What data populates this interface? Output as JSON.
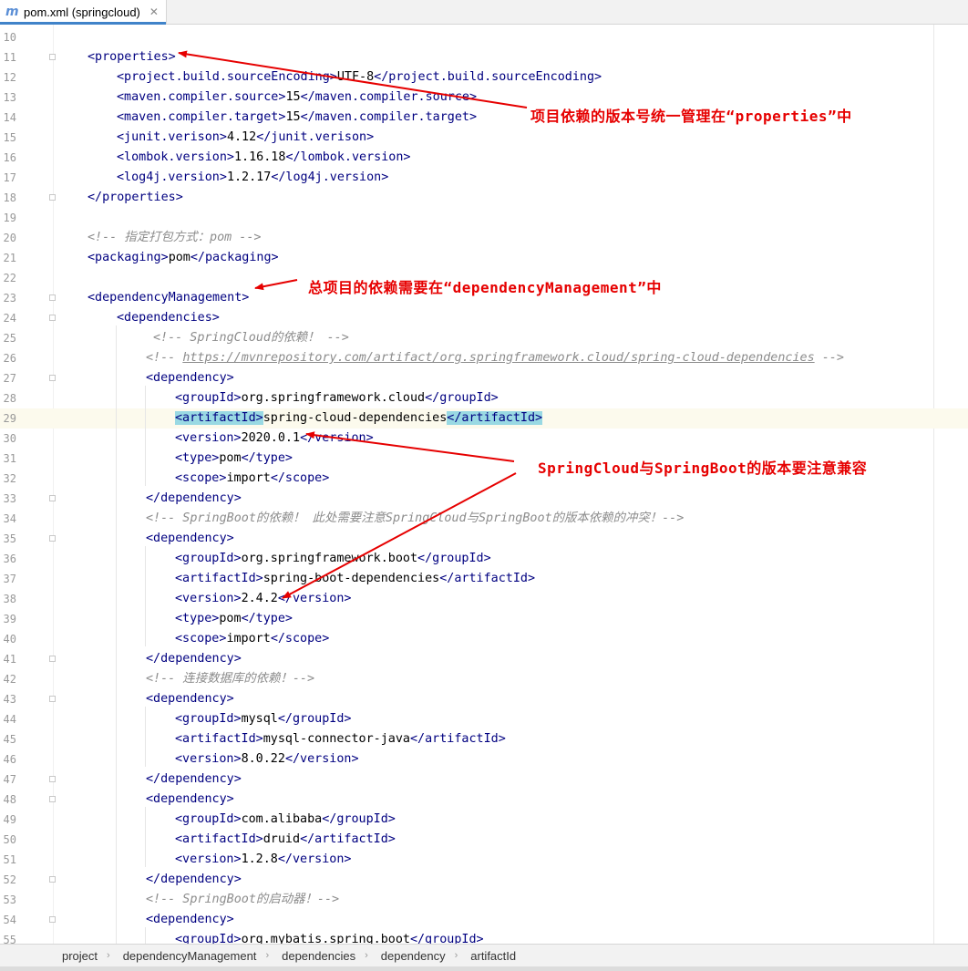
{
  "tab": {
    "icon": "maven-m-icon",
    "icon_glyph": "m",
    "title": "pom.xml (springcloud)",
    "close": "✕"
  },
  "lines": [
    {
      "n": "10",
      "indent": 0,
      "parts": []
    },
    {
      "n": "11",
      "indent": 0,
      "fold": true,
      "parts": [
        [
          "tg",
          "<properties>"
        ]
      ]
    },
    {
      "n": "12",
      "indent": 1,
      "parts": [
        [
          "tg",
          "<project.build.sourceEncoding>"
        ],
        [
          "tx",
          "UTF-8"
        ],
        [
          "tg",
          "</project.build.sourceEncoding>"
        ]
      ]
    },
    {
      "n": "13",
      "indent": 1,
      "parts": [
        [
          "tg",
          "<maven.compiler.source>"
        ],
        [
          "tx",
          "15"
        ],
        [
          "tg",
          "</maven.compiler.source>"
        ]
      ]
    },
    {
      "n": "14",
      "indent": 1,
      "parts": [
        [
          "tg",
          "<maven.compiler.target>"
        ],
        [
          "tx",
          "15"
        ],
        [
          "tg",
          "</maven.compiler.target>"
        ]
      ]
    },
    {
      "n": "15",
      "indent": 1,
      "parts": [
        [
          "tg",
          "<junit.verison>"
        ],
        [
          "tx",
          "4.12"
        ],
        [
          "tg",
          "</junit.verison>"
        ]
      ]
    },
    {
      "n": "16",
      "indent": 1,
      "parts": [
        [
          "tg",
          "<lombok.version>"
        ],
        [
          "tx",
          "1.16.18"
        ],
        [
          "tg",
          "</lombok.version>"
        ]
      ]
    },
    {
      "n": "17",
      "indent": 1,
      "parts": [
        [
          "tg",
          "<log4j.version>"
        ],
        [
          "tx",
          "1.2.17"
        ],
        [
          "tg",
          "</log4j.version>"
        ]
      ]
    },
    {
      "n": "18",
      "indent": 0,
      "fold": true,
      "parts": [
        [
          "tg",
          "</properties>"
        ]
      ]
    },
    {
      "n": "19",
      "indent": 0,
      "parts": []
    },
    {
      "n": "20",
      "indent": 0,
      "parts": [
        [
          "cm",
          "<!-- 指定打包方式：pom -->"
        ]
      ]
    },
    {
      "n": "21",
      "indent": 0,
      "parts": [
        [
          "tg",
          "<packaging>"
        ],
        [
          "tx",
          "pom"
        ],
        [
          "tg",
          "</packaging>"
        ]
      ]
    },
    {
      "n": "22",
      "indent": 0,
      "parts": []
    },
    {
      "n": "23",
      "indent": 0,
      "fold": true,
      "parts": [
        [
          "tg",
          "<dependencyManagement>"
        ]
      ]
    },
    {
      "n": "24",
      "indent": 1,
      "fold": true,
      "parts": [
        [
          "tg",
          "<dependencies>"
        ]
      ]
    },
    {
      "n": "25",
      "indent": 2.25,
      "parts": [
        [
          "cm",
          "<!-- SpringCloud的依赖！ -->"
        ]
      ]
    },
    {
      "n": "26",
      "indent": 2,
      "parts": [
        [
          "cm",
          "<!-- "
        ],
        [
          "url",
          "https://mvnrepository.com/artifact/org.springframework.cloud/spring-cloud-dependencies"
        ],
        [
          "cm",
          " -->"
        ]
      ]
    },
    {
      "n": "27",
      "indent": 2,
      "fold": true,
      "parts": [
        [
          "tg",
          "<dependency>"
        ]
      ]
    },
    {
      "n": "28",
      "indent": 3,
      "parts": [
        [
          "tg",
          "<groupId>"
        ],
        [
          "tx",
          "org.springframework.cloud"
        ],
        [
          "tg",
          "</groupId>"
        ]
      ]
    },
    {
      "n": "29",
      "indent": 3,
      "hl": true,
      "parts": [
        [
          "tgm",
          "<artifactId>"
        ],
        [
          "tx",
          "spring-cloud-dependencies"
        ],
        [
          "tgm",
          "</artifactId>"
        ]
      ]
    },
    {
      "n": "30",
      "indent": 3,
      "parts": [
        [
          "tg",
          "<version>"
        ],
        [
          "tx",
          "2020.0.1"
        ],
        [
          "tg",
          "</version>"
        ]
      ]
    },
    {
      "n": "31",
      "indent": 3,
      "parts": [
        [
          "tg",
          "<type>"
        ],
        [
          "tx",
          "pom"
        ],
        [
          "tg",
          "</type>"
        ]
      ]
    },
    {
      "n": "32",
      "indent": 3,
      "parts": [
        [
          "tg",
          "<scope>"
        ],
        [
          "tx",
          "import"
        ],
        [
          "tg",
          "</scope>"
        ]
      ]
    },
    {
      "n": "33",
      "indent": 2,
      "fold": true,
      "parts": [
        [
          "tg",
          "</dependency>"
        ]
      ]
    },
    {
      "n": "34",
      "indent": 2,
      "parts": [
        [
          "cm",
          "<!-- SpringBoot的依赖！ 此处需要注意SpringCloud与SpringBoot的版本依赖的冲突！-->"
        ]
      ]
    },
    {
      "n": "35",
      "indent": 2,
      "fold": true,
      "parts": [
        [
          "tg",
          "<dependency>"
        ]
      ]
    },
    {
      "n": "36",
      "indent": 3,
      "parts": [
        [
          "tg",
          "<groupId>"
        ],
        [
          "tx",
          "org.springframework.boot"
        ],
        [
          "tg",
          "</groupId>"
        ]
      ]
    },
    {
      "n": "37",
      "indent": 3,
      "parts": [
        [
          "tg",
          "<artifactId>"
        ],
        [
          "tx",
          "spring-boot-dependencies"
        ],
        [
          "tg",
          "</artifactId>"
        ]
      ]
    },
    {
      "n": "38",
      "indent": 3,
      "parts": [
        [
          "tg",
          "<version>"
        ],
        [
          "tx",
          "2.4.2"
        ],
        [
          "tg",
          "</version>"
        ]
      ]
    },
    {
      "n": "39",
      "indent": 3,
      "parts": [
        [
          "tg",
          "<type>"
        ],
        [
          "tx",
          "pom"
        ],
        [
          "tg",
          "</type>"
        ]
      ]
    },
    {
      "n": "40",
      "indent": 3,
      "parts": [
        [
          "tg",
          "<scope>"
        ],
        [
          "tx",
          "import"
        ],
        [
          "tg",
          "</scope>"
        ]
      ]
    },
    {
      "n": "41",
      "indent": 2,
      "fold": true,
      "parts": [
        [
          "tg",
          "</dependency>"
        ]
      ]
    },
    {
      "n": "42",
      "indent": 2,
      "parts": [
        [
          "cm",
          "<!-- 连接数据库的依赖！-->"
        ]
      ]
    },
    {
      "n": "43",
      "indent": 2,
      "fold": true,
      "parts": [
        [
          "tg",
          "<dependency>"
        ]
      ]
    },
    {
      "n": "44",
      "indent": 3,
      "parts": [
        [
          "tg",
          "<groupId>"
        ],
        [
          "tx",
          "mysql"
        ],
        [
          "tg",
          "</groupId>"
        ]
      ]
    },
    {
      "n": "45",
      "indent": 3,
      "parts": [
        [
          "tg",
          "<artifactId>"
        ],
        [
          "tx",
          "mysql-connector-java"
        ],
        [
          "tg",
          "</artifactId>"
        ]
      ]
    },
    {
      "n": "46",
      "indent": 3,
      "parts": [
        [
          "tg",
          "<version>"
        ],
        [
          "tx",
          "8.0.22"
        ],
        [
          "tg",
          "</version>"
        ]
      ]
    },
    {
      "n": "47",
      "indent": 2,
      "fold": true,
      "parts": [
        [
          "tg",
          "</dependency>"
        ]
      ]
    },
    {
      "n": "48",
      "indent": 2,
      "fold": true,
      "parts": [
        [
          "tg",
          "<dependency>"
        ]
      ]
    },
    {
      "n": "49",
      "indent": 3,
      "parts": [
        [
          "tg",
          "<groupId>"
        ],
        [
          "tx",
          "com.alibaba"
        ],
        [
          "tg",
          "</groupId>"
        ]
      ]
    },
    {
      "n": "50",
      "indent": 3,
      "parts": [
        [
          "tg",
          "<artifactId>"
        ],
        [
          "tx",
          "druid"
        ],
        [
          "tg",
          "</artifactId>"
        ]
      ]
    },
    {
      "n": "51",
      "indent": 3,
      "parts": [
        [
          "tg",
          "<version>"
        ],
        [
          "tx",
          "1.2.8"
        ],
        [
          "tg",
          "</version>"
        ]
      ]
    },
    {
      "n": "52",
      "indent": 2,
      "fold": true,
      "parts": [
        [
          "tg",
          "</dependency>"
        ]
      ]
    },
    {
      "n": "53",
      "indent": 2,
      "parts": [
        [
          "cm",
          "<!-- SpringBoot的启动器！-->"
        ]
      ]
    },
    {
      "n": "54",
      "indent": 2,
      "fold": true,
      "parts": [
        [
          "tg",
          "<dependency>"
        ]
      ]
    },
    {
      "n": "55",
      "indent": 3,
      "parts": [
        [
          "tg",
          "<groupId>"
        ],
        [
          "tx",
          "org.mybatis.spring.boot"
        ],
        [
          "tg",
          "</groupId>"
        ]
      ]
    }
  ],
  "annotations": {
    "properties_note": "项目依赖的版本号统一管理在“properties”中",
    "dependency_mgmt_note": "总项目的依赖需要在“dependencyManagement”中",
    "compat_note": "SpringCloud与SpringBoot的版本要注意兼容"
  },
  "annotation_color": "#e60000",
  "breadcrumb": [
    "project",
    "dependencyManagement",
    "dependencies",
    "dependency",
    "artifactId"
  ]
}
